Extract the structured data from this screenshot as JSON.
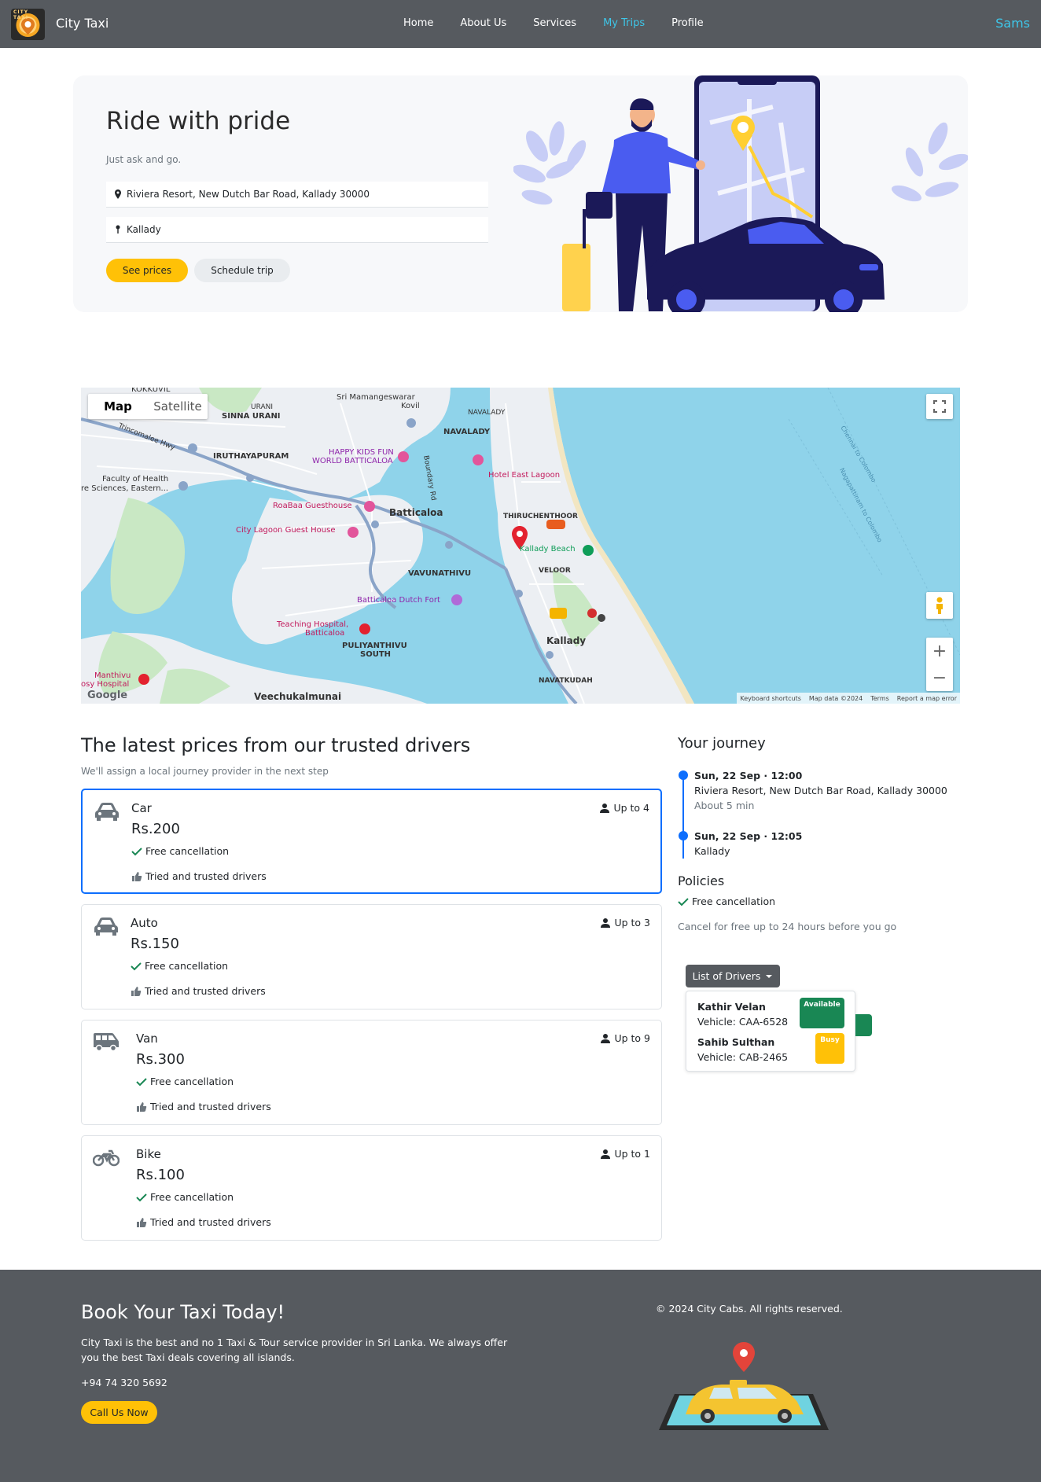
{
  "navbar": {
    "brand": "City Taxi",
    "logo_text": "CITY TAXI",
    "links": [
      "Home",
      "About Us",
      "Services",
      "My Trips",
      "Profile"
    ],
    "active_link": "My Trips",
    "user": "Sams"
  },
  "hero": {
    "title": "Ride with pride",
    "subtitle": "Just ask and go.",
    "pickup": "Riviera Resort, New Dutch Bar Road, Kallady 30000",
    "dropoff": "Kallady",
    "see_prices": "See prices",
    "schedule": "Schedule trip"
  },
  "map": {
    "tab_map": "Map",
    "tab_satellite": "Satellite",
    "zoom_in": "+",
    "zoom_out": "−",
    "attrib": [
      "Keyboard shortcuts",
      "Map data ©2024",
      "Terms",
      "Report a map error"
    ],
    "google": "Google",
    "labels": {
      "kokkuvil": "KOKKUVIL",
      "mamangeswarar": "Sri Mamangeswarar",
      "kovil": "Kovil",
      "urani": "URANI",
      "sinna_urani": "SINNA URANI",
      "navalady1": "NAVALADY",
      "navalady2": "NAVALADY",
      "trinco": "Trincomalee Hwy",
      "iruthayapuram": "IRUTHAYAPURAM",
      "happy_kids1": "HAPPY KIDS FUN",
      "happy_kids2": "WORLD BATTICALOA",
      "hotel_east": "Hotel East Lagoon",
      "faculty1": "Faculty of Health",
      "faculty2": "re Sciences, Eastern...",
      "boundary": "Boundary Rd",
      "roabaa": "RoaBaa Guesthouse",
      "batticaloa": "Batticaloa",
      "thiruchenthoor": "THIRUCHENTHOOR",
      "city_lagoon": "City Lagoon Guest House",
      "kallady_beach": "Kallady Beach",
      "vavunathivu": "VAVUNATHIVU",
      "veloor": "VELOOR",
      "dutch_fort": "Batticaloa Dutch Fort",
      "teaching1": "Teaching Hospital,",
      "teaching2": "Batticaloa",
      "puliyanthivu1": "PULIYANTHIVU",
      "puliyanthivu2": "SOUTH",
      "kallady": "Kallady",
      "manthivu1": "Manthivu",
      "manthivu2": "osy Hospital",
      "navatkudah": "NAVATKUDAH",
      "veechukalmunai": "Veechukalmunai",
      "sea1": "Chennai to Colombo",
      "sea2": "Nagapattinam to Colombo"
    },
    "colors": {
      "water": "#8fd3ea",
      "land": "#eceff3",
      "park": "#c9e8c4",
      "road": "#ffffff",
      "highway": "#8aa4c8",
      "pin": "#e3222f"
    }
  },
  "prices": {
    "title": "The latest prices from our trusted drivers",
    "subtitle": "We'll assign a local journey provider in the next step",
    "vehicles": [
      {
        "name": "Car",
        "price": "Rs.200",
        "capacity": "Up to 4",
        "free": "Free cancellation",
        "trusted": "Tried and trusted drivers",
        "icon": "car-icon",
        "selected": true
      },
      {
        "name": "Auto",
        "price": "Rs.150",
        "capacity": "Up to 3",
        "free": "Free cancellation",
        "trusted": "Tried and trusted drivers",
        "icon": "auto-icon",
        "selected": false
      },
      {
        "name": "Van",
        "price": "Rs.300",
        "capacity": "Up to 9",
        "free": "Free cancellation",
        "trusted": "Tried and trusted drivers",
        "icon": "van-icon",
        "selected": false
      },
      {
        "name": "Bike",
        "price": "Rs.100",
        "capacity": "Up to 1",
        "free": "Free cancellation",
        "trusted": "Tried and trusted drivers",
        "icon": "bike-icon",
        "selected": false
      }
    ]
  },
  "journey": {
    "title": "Your journey",
    "stops": [
      {
        "date": "Sun, 22 Sep · 12:00",
        "place": "Riviera Resort, New Dutch Bar Road, Kallady 30000",
        "note": "About 5 min"
      },
      {
        "date": "Sun, 22 Sep · 12:05",
        "place": "Kallady"
      }
    ],
    "policies_title": "Policies",
    "policy": "Free cancellation",
    "policy_note": "Cancel for free up to 24 hours before you go"
  },
  "drivers": {
    "button": "List of Drivers",
    "list": [
      {
        "name": "Kathir Velan",
        "vehicle": "Vehicle: CAA-6528",
        "status": "Available"
      },
      {
        "name": "Sahib Sulthan",
        "vehicle": "Vehicle: CAB-2465",
        "status": "Busy"
      }
    ]
  },
  "footer": {
    "title": "Book Your Taxi Today!",
    "text": "City Taxi is the best and no 1 Taxi & Tour service provider in Sri Lanka. We always offer you the best Taxi deals covering all islands.",
    "phone": "+94 74 320 5692",
    "button": "Call Us Now",
    "copyright": "© 2024 City Cabs. All rights reserved."
  },
  "colors": {
    "accent": "#ffc107",
    "primary": "#0d6efd",
    "nav_bg": "#565a5f",
    "nav_active": "#3ec6e8",
    "success": "#198754"
  }
}
